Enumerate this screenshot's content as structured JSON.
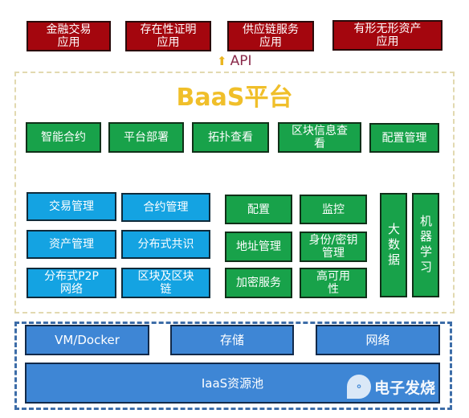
{
  "applications": [
    {
      "line1": "金融交易",
      "line2": "应用"
    },
    {
      "line1": "存在性证明",
      "line2": "应用"
    },
    {
      "line1": "供应链服务",
      "line2": "应用"
    },
    {
      "line1": "有形无形资产",
      "line2": "应用"
    }
  ],
  "api": {
    "icon": "up-arrow-icon",
    "label": "API"
  },
  "baas": {
    "title": "BaaS平台",
    "top_services": [
      "智能合约",
      "平台部署",
      "拓扑查看",
      "区块信息查看",
      "配置管理"
    ],
    "core_modules": [
      "交易管理",
      "合约管理",
      "资产管理",
      "分布式共识",
      "分布式P2P网络",
      "区块及区块链"
    ],
    "support_modules": [
      "配置",
      "监控",
      "地址管理",
      "身份/密钥管理",
      "加密服务",
      "高可用性"
    ],
    "vertical_modules": [
      "大数据",
      "机器学习"
    ]
  },
  "iaas": {
    "resources": [
      "VM/Docker",
      "存储",
      "网络"
    ],
    "pool": "IaaS资源池"
  },
  "watermark": {
    "text": "电子发烧"
  },
  "colors": {
    "app_red": "#a4060e",
    "service_green": "#18a24a",
    "core_cyan": "#14a3e2",
    "iaas_blue": "#3e86d5",
    "title_yellow": "#f0bf2a"
  }
}
